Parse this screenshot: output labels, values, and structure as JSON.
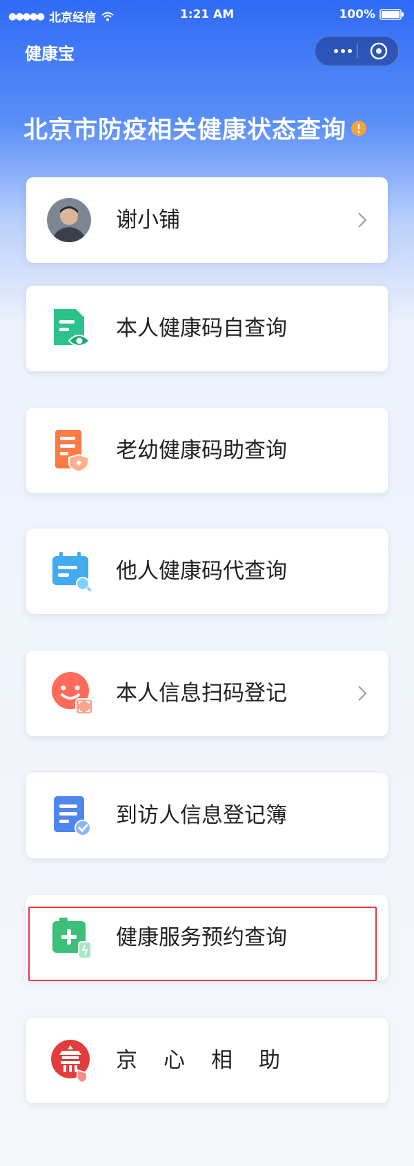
{
  "status_bar": {
    "signal_dots": "●●●●●",
    "carrier": "北京经信",
    "time": "1:21 AM",
    "battery": "100%"
  },
  "nav": {
    "title": "健康宝",
    "more_label": "···"
  },
  "page_title": "北京市防疫相关健康状态查询",
  "user": {
    "name": "谢小铺"
  },
  "menu": [
    {
      "label": "本人健康码自查询",
      "icon": "health-code-self-icon"
    },
    {
      "label": "老幼健康码助查询",
      "icon": "health-code-assist-icon"
    },
    {
      "label": "他人健康码代查询",
      "icon": "health-code-proxy-icon"
    },
    {
      "label": "本人信息扫码登记",
      "icon": "scan-register-icon"
    },
    {
      "label": "到访人信息登记簿",
      "icon": "visitor-log-icon"
    },
    {
      "label": "健康服务预约查询",
      "icon": "health-appointment-icon"
    },
    {
      "label": "京心相助",
      "icon": "jingxin-help-icon"
    }
  ],
  "colors": {
    "brand_blue": "#2e6bf5",
    "green": "#2ec28b",
    "orange": "#ff7a45",
    "sky": "#42aaf0",
    "coral": "#ff6b5a",
    "indigo": "#4f86ee",
    "emerald": "#3dbf7a",
    "red": "#e23c3c",
    "highlight": "#e33b3b"
  }
}
